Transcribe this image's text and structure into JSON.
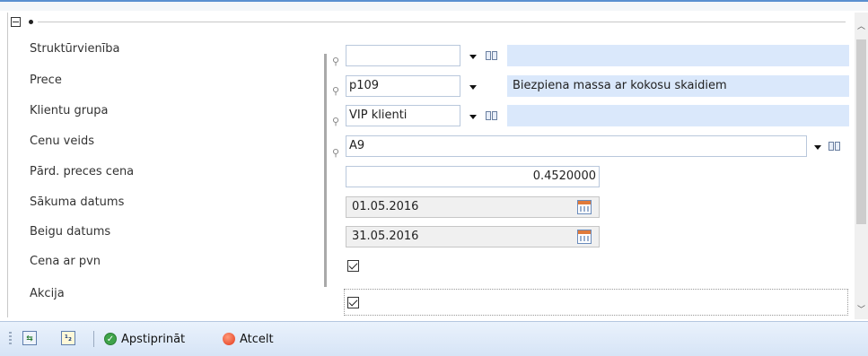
{
  "form": {
    "fields": [
      {
        "label": "Struktūrvienība"
      },
      {
        "label": "Prece"
      },
      {
        "label": "Klientu grupa"
      },
      {
        "label": "Cenu veids"
      },
      {
        "label": "Pārd. preces cena"
      },
      {
        "label": "Sākuma datums"
      },
      {
        "label": "Beigu datums"
      },
      {
        "label": "Cena ar pvn"
      },
      {
        "label": "Akcija"
      }
    ],
    "strukturvieniba": {
      "value": "",
      "description": ""
    },
    "prece": {
      "value": "p109",
      "description": "Biezpiena massa ar kokosu skaidiem"
    },
    "klientu_grupa": {
      "value": "VIP klienti",
      "description": ""
    },
    "cenu_veids": {
      "value": "A9"
    },
    "pard_preces_cena": {
      "value": "0.4520000"
    },
    "sakuma_datums": {
      "value": "01.05.2016"
    },
    "beigu_datums": {
      "value": "31.05.2016"
    },
    "cena_ar_pvn": {
      "checked": true
    },
    "akcija": {
      "checked": true
    }
  },
  "toolbar": {
    "confirm_label": "Apstiprināt",
    "cancel_label": "Atcelt"
  },
  "colors": {
    "accent": "#5a8fd0",
    "description_bg": "#dae8fb",
    "toolbar_bg": "#d6e4f6"
  }
}
